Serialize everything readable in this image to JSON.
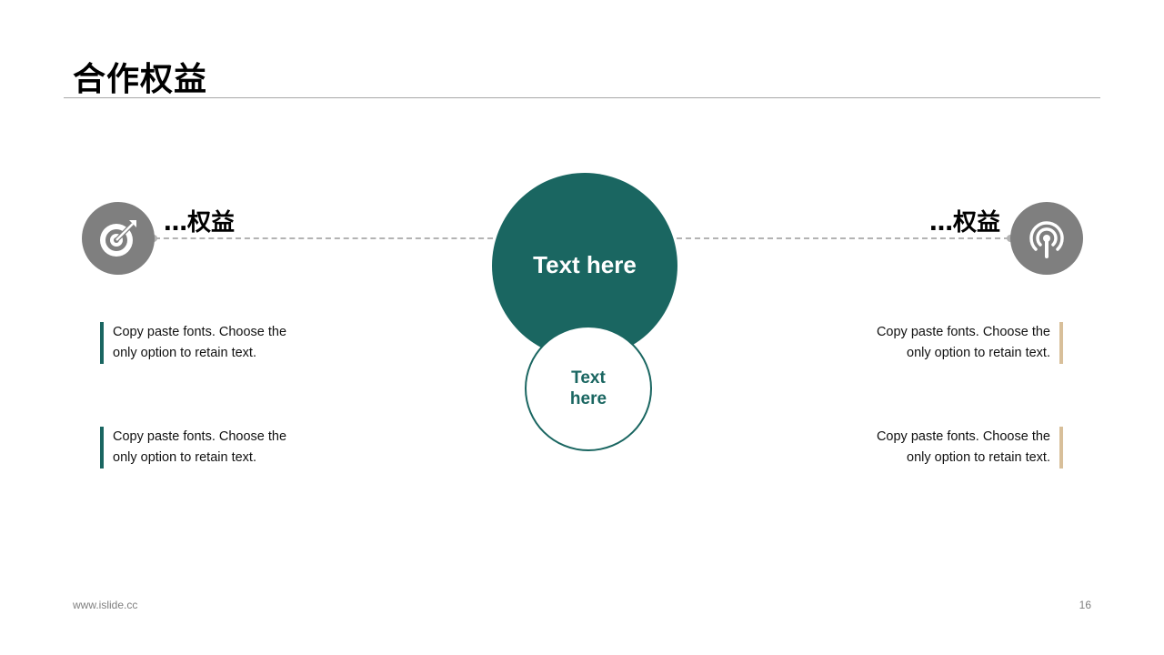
{
  "slide": {
    "title": "合作权益",
    "footer_url": "www.islide.cc",
    "page_number": "16"
  },
  "left_section": {
    "heading": "…权益",
    "icon": "target-icon",
    "items": [
      {
        "line1": "Copy paste fonts. Choose the",
        "line2": "only option to retain text."
      },
      {
        "line1": "Copy paste fonts. Choose the",
        "line2": "only option to retain text."
      }
    ]
  },
  "right_section": {
    "heading": "…权益",
    "icon": "broadcast-icon",
    "items": [
      {
        "line1": "Copy paste fonts. Choose the",
        "line2": "only option to retain text."
      },
      {
        "line1": "Copy paste fonts. Choose the",
        "line2": "only option to retain text."
      }
    ]
  },
  "center": {
    "big_label": "Text here",
    "small_label": "Text here"
  },
  "colors": {
    "primary": "#1a6661",
    "accent": "#d8bf9a",
    "icon_bg": "#7f7f7f",
    "dashed": "#b3b3b3"
  }
}
